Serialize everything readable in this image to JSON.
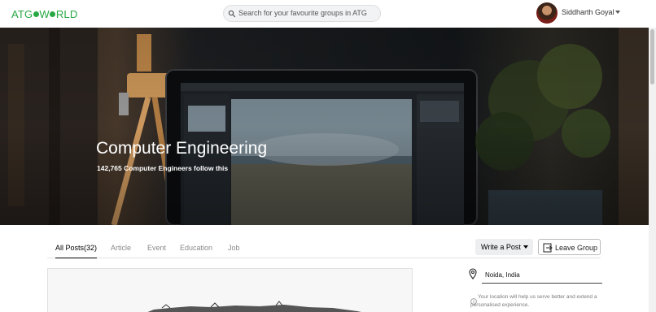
{
  "header": {
    "logo": {
      "left": "ATG",
      "right": "W",
      "tail": "RLD"
    },
    "search_placeholder": "Search for your favourite groups in ATG",
    "user_name": "Siddharth Goyal"
  },
  "banner": {
    "title": "Computer Engineering",
    "subtitle": "142,765 Computer Engineers follow this"
  },
  "tabs": [
    {
      "label": "All Posts(32)",
      "active": true
    },
    {
      "label": "Article"
    },
    {
      "label": "Event"
    },
    {
      "label": "Education"
    },
    {
      "label": "Job"
    }
  ],
  "actions": {
    "write_post": "Write a Post",
    "leave_group": "Leave Group"
  },
  "location": {
    "value": "Noida, India",
    "note": "Your location will help us serve better and extend a personalised experience."
  },
  "colors": {
    "brand_green": "#27a844"
  },
  "icons": [
    "search-icon",
    "chevron-down-icon",
    "leave-icon",
    "location-pin-icon",
    "info-icon"
  ]
}
